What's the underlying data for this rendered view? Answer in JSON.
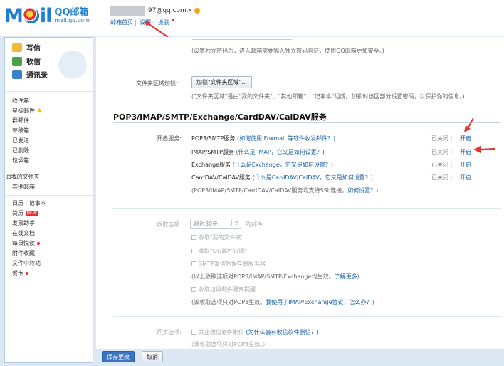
{
  "header": {
    "logo_letters_left": "M",
    "logo_letters_right": "il",
    "logo_cn": "QQ邮箱",
    "logo_domain": "mail.qq.com",
    "email": ".97@qq.com>",
    "links": [
      "邮箱首页",
      "设置",
      "换肤"
    ]
  },
  "sidebar": {
    "quick": [
      "写信",
      "收信",
      "通讯录"
    ],
    "folders": [
      "收件箱",
      "星标邮件",
      "群邮件",
      "草稿箱",
      "已发送",
      "已删除",
      "垃圾箱"
    ],
    "my_folders_label": "⊞我的文件夹",
    "other_mail": "其他邮箱",
    "tools": {
      "calendar": "日历",
      "notes": "记事本",
      "resume": "简历",
      "resume_badge": "NEW",
      "invoice": "发票助手",
      "docs": "在线文档",
      "daily": "每日悦读",
      "attachments": "附件收藏",
      "transfer": "文件中转站",
      "cards": "贺卡"
    }
  },
  "main": {
    "top_hint": "(设置独立密码后，进入邮箱需要输入独立密码验证，使用QQ邮箱更加安全。)",
    "folder_area_label": "文件夹区域加锁：",
    "folder_area_button": "加锁\"文件夹区域\"...",
    "folder_area_hint": "(\"文件夹区域\"是由\"我的文件夹\"、\"其他邮箱\"、\"记事本\"组成。加锁时该区部分设置密码，以保护你的信息。)",
    "section_title": "POP3/IMAP/SMTP/Exchange/CardDAV/CalDAV服务",
    "enable_label": "开启服务:",
    "services": [
      {
        "name": "POP3/SMTP服务",
        "link": "(如何使用 Foxmail 等软件收发邮件？)",
        "status": "已关闭",
        "action": "开启"
      },
      {
        "name": "IMAP/SMTP服务",
        "link": "(什么是 IMAP，它又是如何设置？)",
        "status": "已关闭",
        "action": "开启"
      },
      {
        "name": "Exchange服务",
        "link": "(什么是Exchange，它又是如何设置？)",
        "status": "已关闭",
        "action": "开启"
      },
      {
        "name": "CardDAV/CalDAV服务",
        "link": "(什么是CardDAV/CalDAV，它又是如何设置？)",
        "status": "已关闭",
        "action": "开启"
      }
    ],
    "ssl_note": "(POP3/IMAP/SMTP/CardDAV/CalDAV服务均支持SSL连接。",
    "ssl_link": "如何设置？",
    "ssl_end": ")",
    "recv_label": "收取选项:",
    "recv_select": "最近30天",
    "recv_select_arrow": "≑",
    "recv_suffix": "的邮件",
    "recv_options": [
      "收取\"我的文件夹\"",
      "收取\"QQ邮件订阅\"",
      "SMTP发信后保存到服务器"
    ],
    "recv_note": "(以上收取选项对POP3/IMAP/SMTP/Exchange均生效。",
    "recv_note_link": "了解更多",
    "recv_note_end": ")",
    "spam_option": "收取垃圾邮件隔离提醒",
    "spam_note": "(该收取选项只对POP3生效。",
    "spam_note_link": "我使用了IMAP/Exchange协议，怎么办？",
    "spam_note_end": ")",
    "sync_label": "同步选项:",
    "sync_option": "禁止收信软件删信",
    "sync_option_link": "(为什么会有收信软件删信？)",
    "sync_note": "(该收取选项只对POP3生效。)"
  },
  "bottom": {
    "save": "保存更改",
    "cancel": "取消"
  },
  "colors": {
    "accent_blue": "#1a5fa8",
    "arrow_red": "#e5322d",
    "bg": "#dce9f5"
  }
}
